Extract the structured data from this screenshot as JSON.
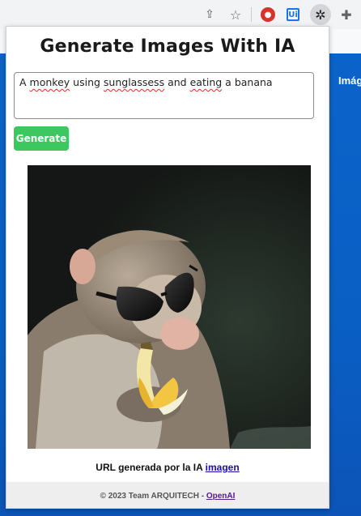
{
  "browser": {
    "toolbar_icons": [
      "share-icon",
      "star-icon",
      "shield-extension-icon",
      "uipath-extension-icon",
      "openai-extension-icon",
      "puzzle-extensions-icon"
    ],
    "ui_extension_label": "Ui"
  },
  "background_page": {
    "partial_text": "Imág"
  },
  "popup": {
    "title": "Generate Images With IA",
    "prompt_value": "A monkey using sunglassess and eating a banana",
    "prompt_words": [
      "A",
      "monkey",
      "using",
      "sunglassess",
      "and",
      "eating",
      "a",
      "banana"
    ],
    "generate_label": "Generate",
    "result_image_alt": "A monkey using sunglassess and eating a banana",
    "url_text": "URL generada por la IA",
    "url_link": "imagen",
    "footer_text": "© 2023 Team ARQUITECH -",
    "footer_link": "OpenAI"
  },
  "colors": {
    "generate_button": "#3cc85f",
    "page_blue": "#0b63c9",
    "link": "#1a0dab"
  }
}
